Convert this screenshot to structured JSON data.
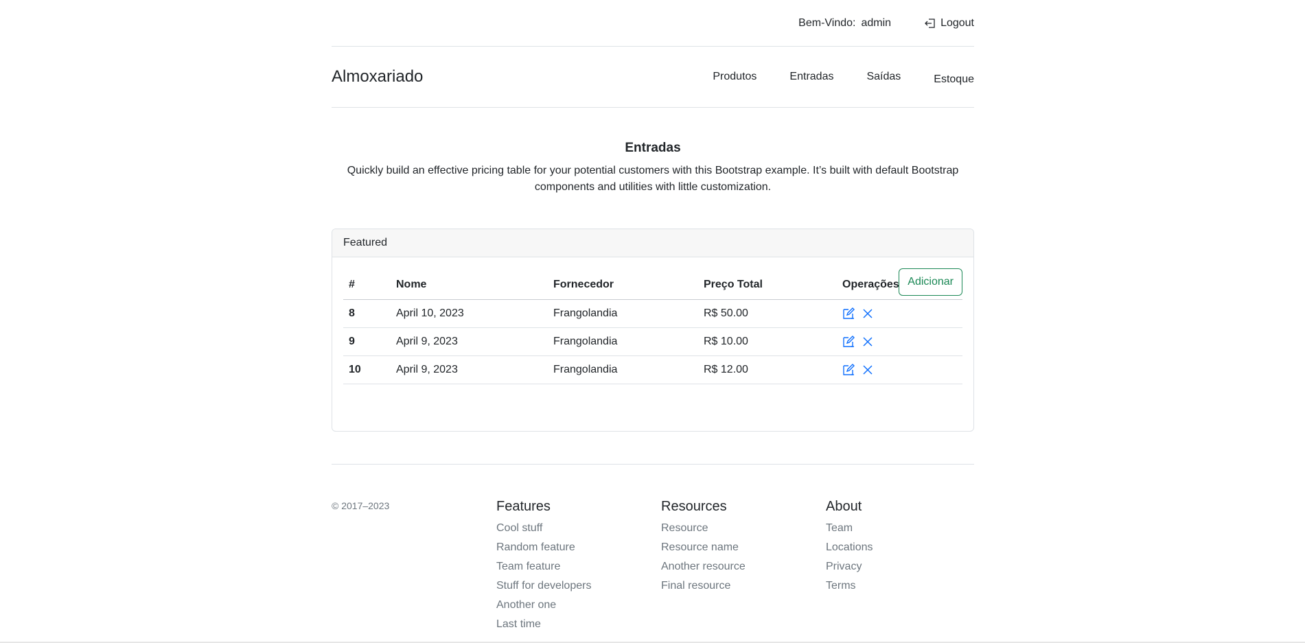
{
  "topbar": {
    "welcome_label": "Bem-Vindo:",
    "username": "admin",
    "logout_label": "Logout"
  },
  "header": {
    "brand": "Almoxariado",
    "nav": {
      "produtos": "Produtos",
      "entradas": "Entradas",
      "saidas": "Saídas",
      "estoque": "Estoque"
    }
  },
  "intro": {
    "title": "Entradas",
    "description": "Quickly build an effective pricing table for your potential customers with this Bootstrap example. It’s built with default Bootstrap components and utilities with little customization."
  },
  "card": {
    "header": "Featured",
    "add_button": "Adicionar",
    "columns": [
      "#",
      "Nome",
      "Fornecedor",
      "Preço Total",
      "Operações"
    ],
    "rows": [
      {
        "id": "8",
        "nome": "April 10, 2023",
        "fornecedor": "Frangolandia",
        "preco": "R$ 50.00"
      },
      {
        "id": "9",
        "nome": "April 9, 2023",
        "fornecedor": "Frangolandia",
        "preco": "R$ 10.00"
      },
      {
        "id": "10",
        "nome": "April 9, 2023",
        "fornecedor": "Frangolandia",
        "preco": "R$ 12.00"
      }
    ],
    "icons": {
      "edit": "edit-icon",
      "delete": "close-icon"
    }
  },
  "footer": {
    "copyright": "© 2017–2023",
    "columns": [
      {
        "title": "Features",
        "links": [
          "Cool stuff",
          "Random feature",
          "Team feature",
          "Stuff for developers",
          "Another one",
          "Last time"
        ]
      },
      {
        "title": "Resources",
        "links": [
          "Resource",
          "Resource name",
          "Another resource",
          "Final resource"
        ]
      },
      {
        "title": "About",
        "links": [
          "Team",
          "Locations",
          "Privacy",
          "Terms"
        ]
      }
    ]
  },
  "colors": {
    "accent_green": "#198754",
    "icon_blue": "#0d6efd",
    "muted": "#6c757d",
    "border": "#dee2e6"
  }
}
